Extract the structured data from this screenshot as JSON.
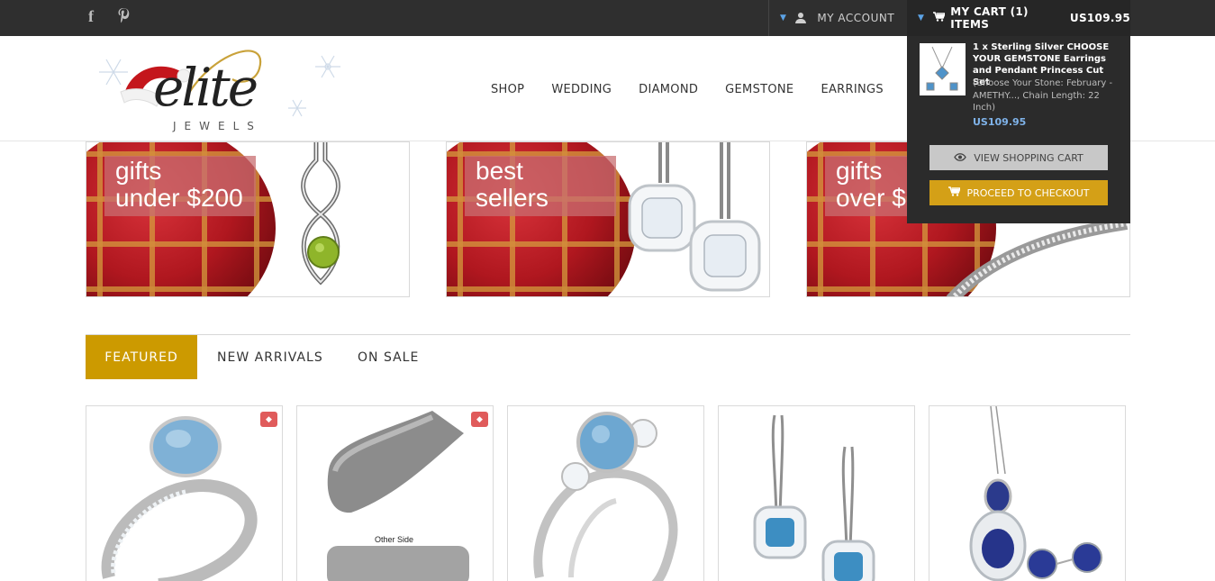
{
  "topbar": {
    "social": [
      {
        "name": "facebook-icon",
        "glyph": "f"
      },
      {
        "name": "pinterest-icon",
        "glyph": "𝓅"
      }
    ],
    "account_label": "MY ACCOUNT",
    "cart_label": "MY CART (1) ITEMS",
    "cart_total": "US109.95"
  },
  "logo": {
    "main": "elite",
    "sub": "JEWELS"
  },
  "nav": [
    "SHOP",
    "WEDDING",
    "DIAMOND",
    "GEMSTONE",
    "EARRINGS",
    "P"
  ],
  "banners": [
    {
      "line1": "gifts",
      "line2": "under $200"
    },
    {
      "line1": "best",
      "line2": "sellers"
    },
    {
      "line1": "gifts",
      "line2": "over $"
    }
  ],
  "cart_dropdown": {
    "item_title": "1 x Sterling Silver CHOOSE YOUR GEMSTONE Earrings and Pendant Princess Cut Set",
    "item_options": "(Choose Your Stone: February - AMETHY..., Chain Length: 22 Inch)",
    "item_price": "US109.95",
    "view_cart_label": "VIEW SHOPPING CART",
    "checkout_label": "PROCEED TO CHECKOUT"
  },
  "tabs": [
    {
      "label": "FEATURED",
      "active": true
    },
    {
      "label": "NEW ARRIVALS",
      "active": false
    },
    {
      "label": "ON SALE",
      "active": false
    }
  ],
  "products": [
    {
      "name": "aquamarine-oval-ring",
      "sale": true
    },
    {
      "name": "money-clip",
      "sale": true,
      "caption": "Other Side"
    },
    {
      "name": "aquamarine-three-stone-ring",
      "sale": false
    },
    {
      "name": "blue-topaz-halo-earrings",
      "sale": false
    },
    {
      "name": "sapphire-pendant-and-studs",
      "sale": false
    }
  ],
  "colors": {
    "topbar": "#2f2f2f",
    "accent_gold": "#cc9a00",
    "price_blue": "#7fb3ea",
    "banner_label": "#c86e70"
  }
}
